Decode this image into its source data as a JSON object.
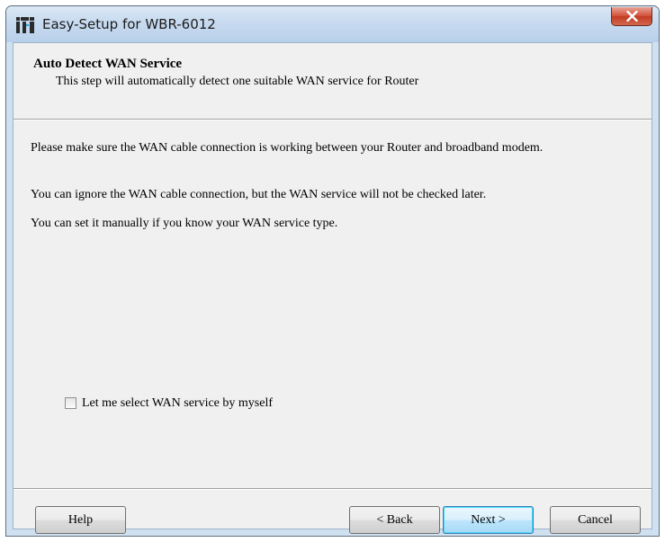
{
  "window": {
    "title": "Easy-Setup for WBR-6012",
    "close_icon": "close-icon"
  },
  "header": {
    "title": "Auto Detect WAN Service",
    "subtitle": "This step will automatically detect one suitable WAN service for Router"
  },
  "body": {
    "paragraphs": [
      "Please make sure the WAN cable connection is working between your Router and broadband modem.",
      "You can ignore the WAN cable connection, but the WAN service will not be checked later.",
      "You can set it manually if you know your WAN service type."
    ],
    "manual_select_checkbox": {
      "label": "Let me select WAN service by myself",
      "checked": false
    }
  },
  "buttons": {
    "help": "Help",
    "back": "< Back",
    "next": "Next >",
    "cancel": "Cancel"
  },
  "colors": {
    "dialog_bg": "#f0f0f0",
    "titlebar": "#c7daef",
    "close_button": "#c23b22"
  }
}
